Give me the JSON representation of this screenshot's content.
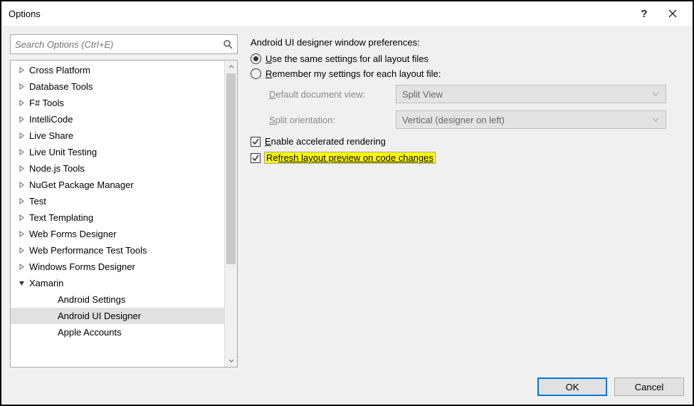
{
  "window": {
    "title": "Options"
  },
  "search": {
    "placeholder": "Search Options (Ctrl+E)"
  },
  "tree": {
    "items": [
      {
        "label": "Cross Platform",
        "level": 1,
        "expandable": true,
        "expanded": false
      },
      {
        "label": "Database Tools",
        "level": 1,
        "expandable": true,
        "expanded": false
      },
      {
        "label": "F# Tools",
        "level": 1,
        "expandable": true,
        "expanded": false
      },
      {
        "label": "IntelliCode",
        "level": 1,
        "expandable": true,
        "expanded": false
      },
      {
        "label": "Live Share",
        "level": 1,
        "expandable": true,
        "expanded": false
      },
      {
        "label": "Live Unit Testing",
        "level": 1,
        "expandable": true,
        "expanded": false
      },
      {
        "label": "Node.js Tools",
        "level": 1,
        "expandable": true,
        "expanded": false
      },
      {
        "label": "NuGet Package Manager",
        "level": 1,
        "expandable": true,
        "expanded": false
      },
      {
        "label": "Test",
        "level": 1,
        "expandable": true,
        "expanded": false
      },
      {
        "label": "Text Templating",
        "level": 1,
        "expandable": true,
        "expanded": false
      },
      {
        "label": "Web Forms Designer",
        "level": 1,
        "expandable": true,
        "expanded": false
      },
      {
        "label": "Web Performance Test Tools",
        "level": 1,
        "expandable": true,
        "expanded": false
      },
      {
        "label": "Windows Forms Designer",
        "level": 1,
        "expandable": true,
        "expanded": false
      },
      {
        "label": "Xamarin",
        "level": 1,
        "expandable": true,
        "expanded": true
      },
      {
        "label": "Android Settings",
        "level": 2,
        "expandable": false
      },
      {
        "label": "Android UI Designer",
        "level": 2,
        "expandable": false,
        "selected": true
      },
      {
        "label": "Apple Accounts",
        "level": 2,
        "expandable": false
      }
    ]
  },
  "prefs": {
    "heading": "Android UI designer window preferences:",
    "radio1": {
      "pre": "U",
      "rest": "se the same settings for all layout files",
      "checked": true
    },
    "radio2": {
      "pre": "R",
      "rest": "emember my settings for each layout file:",
      "checked": false
    },
    "docview": {
      "label_pre": "D",
      "label_rest": "efault document view:",
      "value": "Split View"
    },
    "split": {
      "label_pre": "S",
      "label_rest": "plit orientation:",
      "value": "Vertical (designer on left)"
    },
    "check1": {
      "pre": "E",
      "rest": "nable accelerated rendering",
      "checked": true
    },
    "check2": {
      "pre": "R",
      "mid": "e",
      "rest": "fresh layout preview on code changes",
      "checked": true,
      "highlighted": true
    }
  },
  "buttons": {
    "ok": "OK",
    "cancel": "Cancel"
  }
}
